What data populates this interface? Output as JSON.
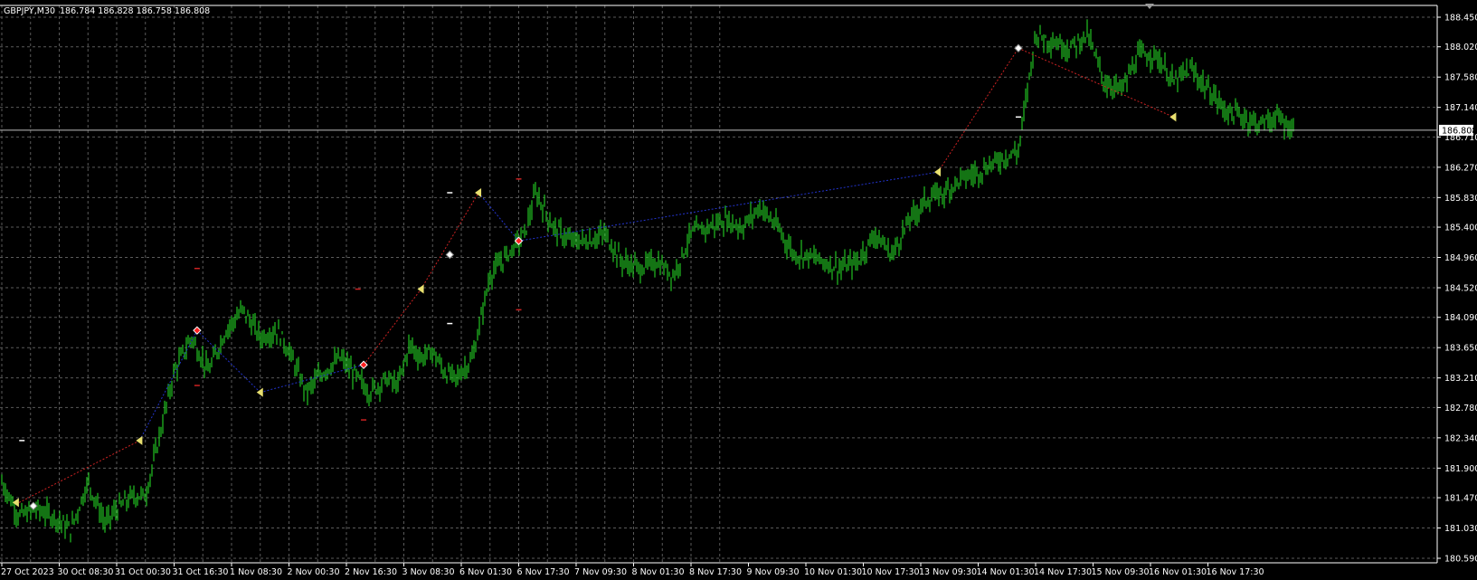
{
  "header": {
    "symbol": "GBPJPY,M30",
    "ohlc": "186.784 186.828 186.758 186.808"
  },
  "colors": {
    "background": "#000000",
    "grid": "#5a5a5a",
    "bars": "#22c322",
    "axis_text": "#ffffff",
    "price_line": "#c0c0c0",
    "zigzag_up": "#cc2222",
    "zigzag_down": "#2233cc",
    "marker_yellow": "#e8e070",
    "marker_red": "#ff2020",
    "marker_white": "#ffffff"
  },
  "chart_data": {
    "type": "line",
    "title": "",
    "xlabel": "",
    "ylabel": "",
    "ylim": [
      180.5,
      188.6
    ],
    "y_ticks": [
      "188.450",
      "188.020",
      "187.580",
      "187.140",
      "186.710",
      "186.270",
      "185.830",
      "185.400",
      "184.960",
      "184.520",
      "184.090",
      "183.650",
      "183.210",
      "182.780",
      "182.340",
      "181.900",
      "181.470",
      "181.030",
      "180.590"
    ],
    "x_ticks": [
      "27 Oct 2023",
      "30 Oct 08:30",
      "31 Oct 00:30",
      "31 Oct 16:30",
      "1 Nov 08:30",
      "2 Nov 00:30",
      "2 Nov 16:30",
      "3 Nov 08:30",
      "6 Nov 01:30",
      "6 Nov 17:30",
      "7 Nov 09:30",
      "8 Nov 01:30",
      "8 Nov 17:30",
      "9 Nov 09:30",
      "10 Nov 01:30",
      "10 Nov 17:30",
      "13 Nov 09:30",
      "14 Nov 01:30",
      "14 Nov 17:30",
      "15 Nov 09:30",
      "16 Nov 01:30",
      "16 Nov 17:30"
    ],
    "current_price": "186.808",
    "current_value": 186.808,
    "series": [
      {
        "x": [
          0,
          0.3,
          0.6,
          0.9,
          1.2,
          1.5,
          1.8,
          2.0,
          2.3,
          2.5,
          2.7,
          3.0,
          3.3,
          3.6,
          3.9,
          4.2,
          4.5,
          4.8,
          5.0,
          5.3,
          5.6,
          5.9,
          6.2,
          6.4,
          6.7,
          6.9,
          7.1,
          7.3,
          7.5,
          7.7,
          7.9,
          8.2,
          8.5,
          8.8,
          9.1,
          9.3,
          9.6,
          9.9,
          10.2,
          10.5,
          10.8,
          11.1,
          11.4,
          11.7,
          12.0,
          12.3,
          12.6,
          12.9,
          13.2,
          13.5,
          13.8,
          14.0,
          14.3,
          14.6,
          14.9,
          15.2,
          15.5,
          15.8,
          16.1,
          16.4,
          16.7,
          17.0,
          17.2,
          17.4,
          17.7,
          18.0,
          18.3,
          18.6,
          18.9,
          19.2,
          19.5,
          19.8,
          20.1,
          20.4,
          20.7,
          21.0,
          21.3,
          21.6,
          21.9,
          22.2,
          22.5
        ],
        "values": [
          181.7,
          181.2,
          181.3,
          181.2,
          181.0,
          181.7,
          181.1,
          181.3,
          181.5,
          181.5,
          182.2,
          183.3,
          183.8,
          183.3,
          183.9,
          184.2,
          183.8,
          183.9,
          183.6,
          183.0,
          183.3,
          183.5,
          183.2,
          183.0,
          183.2,
          183.1,
          183.7,
          183.5,
          183.6,
          183.3,
          183.2,
          183.5,
          184.7,
          185.0,
          185.3,
          185.9,
          185.4,
          185.2,
          185.2,
          185.3,
          184.9,
          184.8,
          184.9,
          184.7,
          185.3,
          185.4,
          185.5,
          185.4,
          185.7,
          185.4,
          185.0,
          185.0,
          184.9,
          184.8,
          184.9,
          185.3,
          185.0,
          185.5,
          185.8,
          185.9,
          186.1,
          186.2,
          186.3,
          186.4,
          186.5,
          188.2,
          188.1,
          188.0,
          188.2,
          187.5,
          187.4,
          187.9,
          187.9,
          187.5,
          187.7,
          187.4,
          187.1,
          187.0,
          186.9,
          187.0,
          186.8
        ]
      }
    ],
    "zigzag": [
      {
        "x": 0.3,
        "y": 181.4,
        "color": "up"
      },
      {
        "x": 2.4,
        "y": 182.3,
        "color": "up"
      },
      {
        "x": 3.4,
        "y": 183.9,
        "color": "down"
      },
      {
        "x": 4.5,
        "y": 183.0,
        "color": "down"
      },
      {
        "x": 6.3,
        "y": 183.4,
        "color": "down"
      },
      {
        "x": 7.3,
        "y": 184.5,
        "color": "up"
      },
      {
        "x": 8.3,
        "y": 185.9,
        "color": "up"
      },
      {
        "x": 9.0,
        "y": 185.2,
        "color": "down"
      },
      {
        "x": 16.3,
        "y": 186.2,
        "color": "down"
      },
      {
        "x": 17.7,
        "y": 188.0,
        "color": "up"
      },
      {
        "x": 20.4,
        "y": 187.0,
        "color": "up"
      }
    ],
    "markers": [
      {
        "x": 0.25,
        "y": 181.4,
        "shape": "yellow-triangle"
      },
      {
        "x": 0.55,
        "y": 181.35,
        "shape": "white-diamond"
      },
      {
        "x": 2.4,
        "y": 182.3,
        "shape": "yellow-triangle"
      },
      {
        "x": 3.4,
        "y": 183.9,
        "shape": "red-diamond"
      },
      {
        "x": 4.5,
        "y": 183.0,
        "shape": "yellow-triangle"
      },
      {
        "x": 6.3,
        "y": 183.4,
        "shape": "red-diamond"
      },
      {
        "x": 7.3,
        "y": 184.5,
        "shape": "yellow-triangle"
      },
      {
        "x": 7.8,
        "y": 185.0,
        "shape": "white-diamond"
      },
      {
        "x": 8.3,
        "y": 185.9,
        "shape": "yellow-triangle"
      },
      {
        "x": 9.0,
        "y": 185.2,
        "shape": "red-diamond"
      },
      {
        "x": 16.3,
        "y": 186.2,
        "shape": "yellow-triangle"
      },
      {
        "x": 17.7,
        "y": 188.0,
        "shape": "white-diamond"
      },
      {
        "x": 20.4,
        "y": 187.0,
        "shape": "yellow-triangle"
      }
    ],
    "dashes": [
      {
        "x": 0.35,
        "y": 182.3,
        "color": "white"
      },
      {
        "x": 3.4,
        "y": 184.8,
        "color": "red"
      },
      {
        "x": 3.4,
        "y": 183.1,
        "color": "red"
      },
      {
        "x": 6.2,
        "y": 184.5,
        "color": "red"
      },
      {
        "x": 6.3,
        "y": 182.6,
        "color": "red"
      },
      {
        "x": 7.8,
        "y": 185.9,
        "color": "white"
      },
      {
        "x": 7.8,
        "y": 184.0,
        "color": "white"
      },
      {
        "x": 9.0,
        "y": 186.1,
        "color": "red"
      },
      {
        "x": 9.0,
        "y": 184.2,
        "color": "red"
      },
      {
        "x": 17.7,
        "y": 187.0,
        "color": "white"
      }
    ],
    "grid": true
  }
}
